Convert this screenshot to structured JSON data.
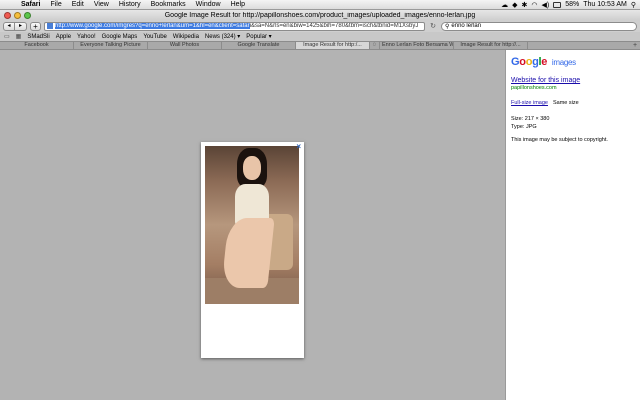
{
  "menubar": {
    "app": "Safari",
    "items": [
      "File",
      "Edit",
      "View",
      "History",
      "Bookmarks",
      "Window",
      "Help"
    ],
    "battery": "58%",
    "clock": "Thu 10:53 AM"
  },
  "window": {
    "title": "Google Image Result for http://papillonshoes.com/product_images/uploaded_images/enno-lerlan.jpg"
  },
  "toolbar": {
    "back": "◂",
    "forward": "▸",
    "add": "+",
    "url_selected": "http://www.google.com/imgres?q=enno+lerlan&um=1&hl=en&client=safar",
    "url_rest": "i&sa=N&rls=en&biw=1425&bih=780&tbm=isch&tbnid=M1XsbyJ",
    "search_value": "enno lerlan"
  },
  "bookmarks": {
    "items": [
      "SMadSli",
      "Apple",
      "Yahoo!",
      "Google Maps",
      "YouTube",
      "Wikipedia",
      "News (324) ▾",
      "Popular ▾"
    ]
  },
  "tabs": [
    {
      "label": "Facebook",
      "active": false
    },
    {
      "label": "Everyone Talking Picture",
      "active": false
    },
    {
      "label": "Wall Photos",
      "active": false
    },
    {
      "label": "Google Translate",
      "active": false
    },
    {
      "label": "Image Result for http:/...",
      "active": true
    },
    {
      "label": "Enno Lerlan Foto Bersama WA...",
      "active": false
    },
    {
      "label": "Image Result for http://...",
      "active": false
    }
  ],
  "viewer": {
    "close": "×"
  },
  "sidebar": {
    "logo_letters": [
      "G",
      "o",
      "o",
      "g",
      "l",
      "e"
    ],
    "logo_suffix": "images",
    "website_link": "Website for this image",
    "domain": "papillonshoes.com",
    "full_size": "Full-size image",
    "same_size": "Same size",
    "size_label": "Size:",
    "size_value": "217 × 380",
    "type_label": "Type:",
    "type_value": "JPG",
    "copyright": "This image may be subject to copyright."
  }
}
